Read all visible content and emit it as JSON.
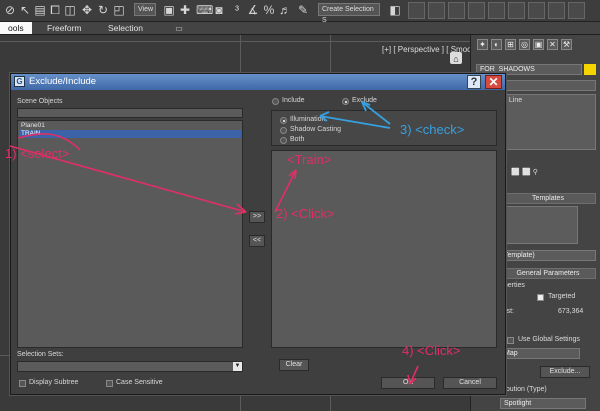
{
  "app": {
    "ribbon_tabs": [
      "ools",
      "Freeform",
      "Selection"
    ],
    "view_dropdown": "View",
    "create_selection_dropdown": "Create Selection S",
    "viewport_label": "[+] [ Perspective ] [ Smooth + ]",
    "command_panel": {
      "object_name": "FOR_SHADOWS",
      "list_item": "t Line",
      "templates_label": "Templates",
      "template_dropdown": "Template)",
      "general_params_label": "General Parameters",
      "properties_label": "operties",
      "targeted_label": "Targeted",
      "dist_label": "Dist:",
      "dist_value": "673,364",
      "use_global_settings_label": "Use Global Settings",
      "shadow_map_dropdown": "Map",
      "exclude_button": "Exclude...",
      "distribution_label": "tribution (Type)",
      "spotlight_dropdown": "Spotlight"
    }
  },
  "dialog": {
    "title": "Exclude/Include",
    "help_glyph": "?",
    "close_glyph": "✕",
    "scene_objects_label": "Scene Objects",
    "scene_objects": [
      {
        "name": "Plane01",
        "selected": false
      },
      {
        "name": "TRAIN",
        "selected": true
      }
    ],
    "move_right_label": ">>",
    "move_left_label": "<<",
    "include_label": "Include",
    "exclude_label": "Exclude",
    "mode": "Exclude",
    "options": [
      {
        "label": "Illumination",
        "selected": true
      },
      {
        "label": "Shadow Casting",
        "selected": false
      },
      {
        "label": "Both",
        "selected": false
      }
    ],
    "selection_sets_label": "Selection Sets:",
    "clear_label": "Clear",
    "display_subtree_label": "Display Subtree",
    "case_sensitive_label": "Case Sensitive",
    "ok_label": "OK",
    "cancel_label": "Cancel"
  },
  "annotations": {
    "select": "1) <select>",
    "click": "2) <Click>",
    "check": "3) <check>",
    "click_ok": "4) <Click>",
    "train": "<Train>"
  },
  "colors": {
    "annotation_pink": "#e22e66",
    "annotation_blue": "#37a0e0",
    "selection_blue": "#3c63a8",
    "title_bar": "#4f7cba",
    "close_red": "#d64a3e",
    "object_color": "#f5d400"
  }
}
